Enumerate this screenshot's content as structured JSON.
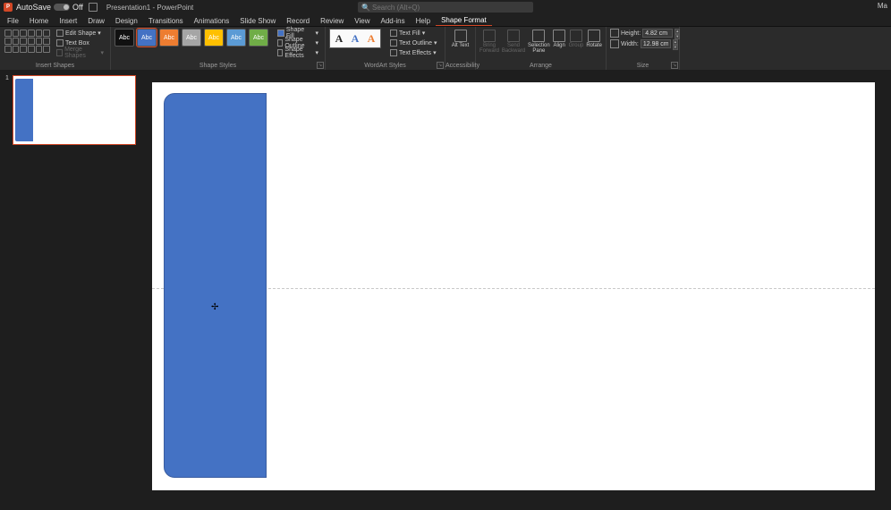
{
  "title": {
    "autosave": "AutoSave",
    "autosave_state": "Off",
    "doc": "Presentation1 - PowerPoint",
    "search_placeholder": "Search (Alt+Q)",
    "user": "Ma"
  },
  "tabs": [
    "File",
    "Home",
    "Insert",
    "Draw",
    "Design",
    "Transitions",
    "Animations",
    "Slide Show",
    "Record",
    "Review",
    "View",
    "Add-ins",
    "Help",
    "Shape Format"
  ],
  "active_tab": 13,
  "ribbon": {
    "insert_shapes": {
      "edit_shape": "Edit Shape",
      "text_box": "Text Box",
      "merge": "Merge Shapes",
      "label": "Insert Shapes"
    },
    "shape_styles": {
      "swatches": [
        {
          "bg": "#111",
          "label": "Abc"
        },
        {
          "bg": "#4472c4",
          "label": "Abc",
          "selected": true
        },
        {
          "bg": "#ed7d31",
          "label": "Abc"
        },
        {
          "bg": "#a5a5a5",
          "label": "Abc"
        },
        {
          "bg": "#ffc000",
          "label": "Abc"
        },
        {
          "bg": "#5b9bd5",
          "label": "Abc"
        },
        {
          "bg": "#70ad47",
          "label": "Abc"
        }
      ],
      "fill": "Shape Fill",
      "outline": "Shape Outline",
      "effects": "Shape Effects",
      "label": "Shape Styles"
    },
    "wordart": {
      "letters": [
        "A",
        "A",
        "A"
      ],
      "colors": [
        "#222",
        "#4472c4",
        "#ed7d31"
      ],
      "fill": "Text Fill",
      "outline": "Text Outline",
      "effects": "Text Effects",
      "label": "WordArt Styles"
    },
    "accessibility": {
      "btn": "Alt Text",
      "label": "Accessibility"
    },
    "arrange": {
      "forward": "Bring Forward",
      "backward": "Send Backward",
      "selection": "Selection Pane",
      "align": "Align",
      "group": "Group",
      "rotate": "Rotate",
      "label": "Arrange"
    },
    "size": {
      "height_lbl": "Height:",
      "height": "4.82 cm",
      "width_lbl": "Width:",
      "width": "12.98 cm",
      "label": "Size"
    }
  },
  "thumb": {
    "num": "1"
  }
}
